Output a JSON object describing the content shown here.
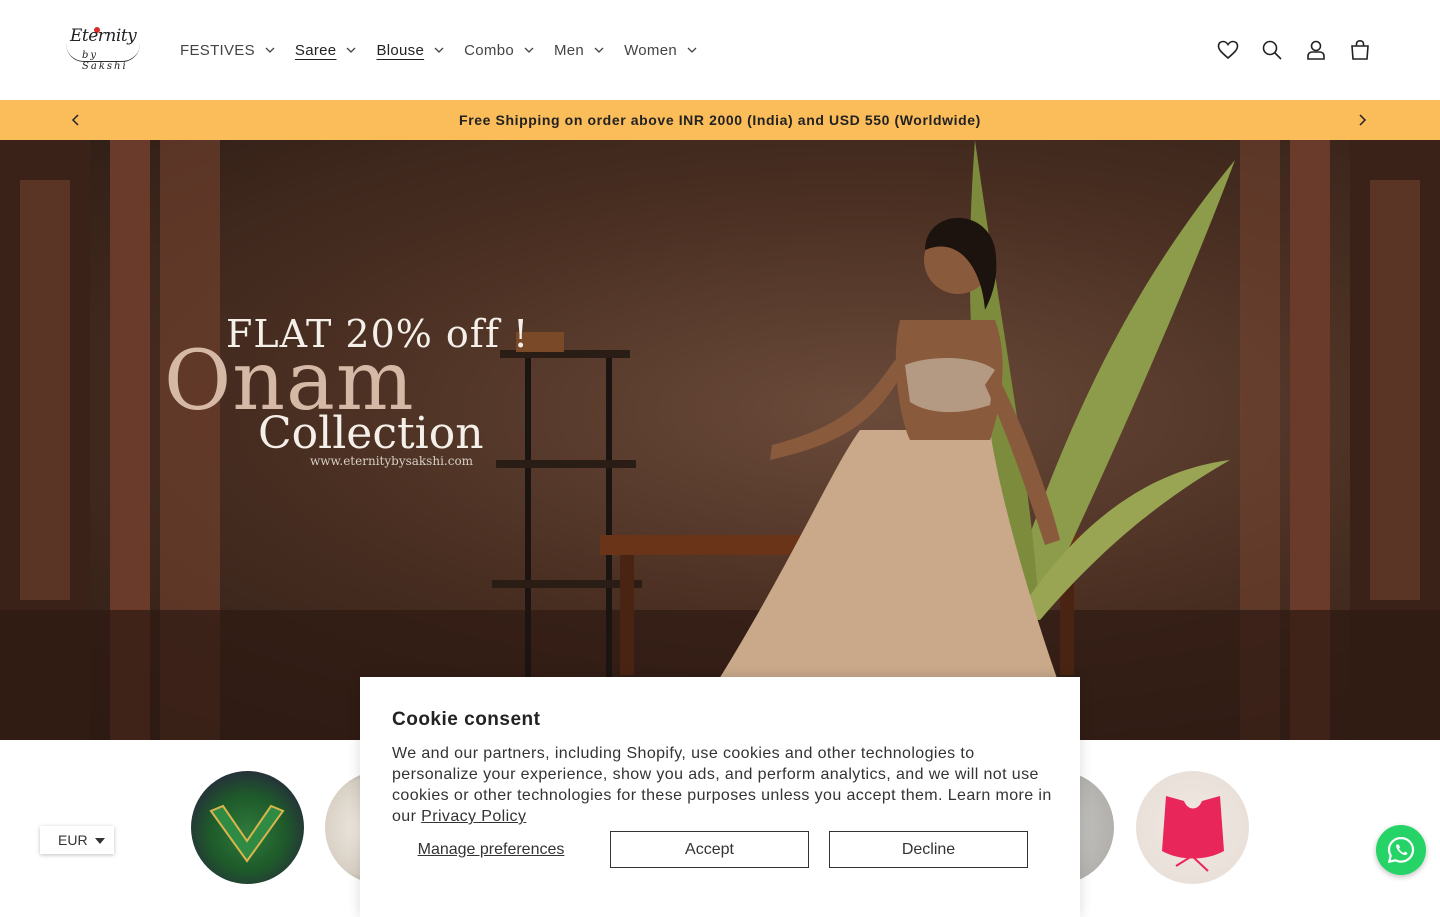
{
  "header": {
    "logo": {
      "text": "Eternity",
      "sub": "by Sakshi"
    },
    "nav": [
      {
        "label": "FESTIVES"
      },
      {
        "label": "Saree"
      },
      {
        "label": "Blouse"
      },
      {
        "label": "Combo"
      },
      {
        "label": "Men"
      },
      {
        "label": "Women"
      }
    ],
    "icons": [
      "heart-icon",
      "search-icon",
      "account-icon",
      "cart-icon"
    ]
  },
  "announcement": {
    "text": "Free Shipping on order above INR 2000 (India) and USD 550 (Worldwide)"
  },
  "hero": {
    "line1": "FLAT 20% off !",
    "line2": "Onam",
    "line3": "Collection",
    "url": "www.eternitybysakshi.com"
  },
  "currency": {
    "selected": "EUR"
  },
  "cookie": {
    "title": "Cookie consent",
    "body": "We and our partners, including Shopify, use cookies and other technologies to personalize your experience, show you ads, and perform analytics, and we will not use cookies or other technologies for these purposes unless you accept them. Learn more in our ",
    "link": "Privacy Policy",
    "manage": "Manage preferences",
    "accept": "Accept",
    "decline": "Decline"
  },
  "colors": {
    "announcement_bg": "#fbbd5a",
    "whatsapp": "#25d366"
  }
}
